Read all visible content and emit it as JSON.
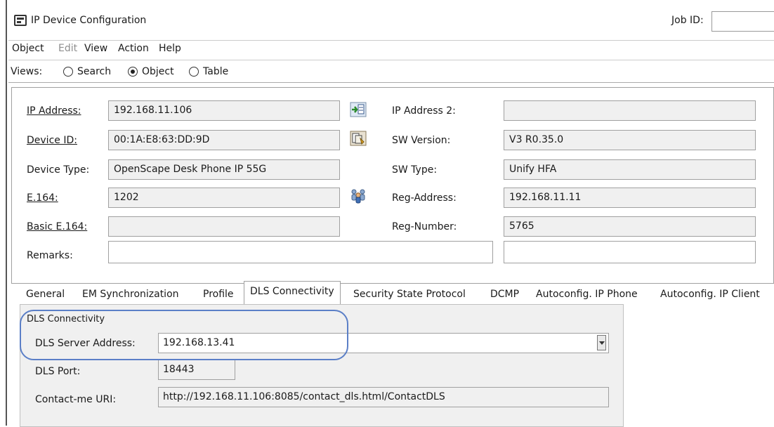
{
  "window": {
    "title": "IP Device Configuration",
    "job_id_label": "Job ID:",
    "job_id_value": ""
  },
  "menu": [
    "Object",
    "Edit",
    "View",
    "Action",
    "Help"
  ],
  "views": {
    "label": "Views:",
    "options": [
      "Search",
      "Object",
      "Table"
    ],
    "selected": "Object"
  },
  "form": {
    "ip_address_label": "IP Address:",
    "ip_address": "192.168.11.106",
    "device_id_label": "Device ID:",
    "device_id": "00:1A:E8:63:DD:9D",
    "device_type_label": "Device Type:",
    "device_type": "OpenScape Desk Phone IP 55G",
    "e164_label": "E.164:",
    "e164": "1202",
    "basic_e164_label": "Basic E.164:",
    "basic_e164": "",
    "remarks_label": "Remarks:",
    "remarks": "",
    "remarks_2": "",
    "ip_address_2_label": "IP Address 2:",
    "ip_address_2": "",
    "sw_version_label": "SW Version:",
    "sw_version": "V3 R0.35.0",
    "sw_type_label": "SW Type:",
    "sw_type": "Unify HFA",
    "reg_address_label": "Reg-Address:",
    "reg_address": "192.168.11.11",
    "reg_number_label": "Reg-Number:",
    "reg_number": "5765"
  },
  "tabs": [
    "General",
    "EM Synchronization",
    "Profile",
    "DLS Connectivity",
    "Security State Protocol",
    "DCMP",
    "Autoconfig. IP Phone",
    "Autoconfig. IP Client"
  ],
  "active_tab": "DLS Connectivity",
  "dls": {
    "group_title": "DLS Connectivity",
    "server_address_label": "DLS Server Address:",
    "server_address": "192.168.13.41",
    "port_label": "DLS Port:",
    "port": "18443",
    "contact_uri_label": "Contact-me URI:",
    "contact_uri": "http://192.168.11.106:8085/contact_dls.html/ContactDLS"
  },
  "colors": {
    "highlight_ring": "#5b7fc7",
    "panel_bg": "#f0f0f0",
    "field_border": "#a0a0a0"
  }
}
